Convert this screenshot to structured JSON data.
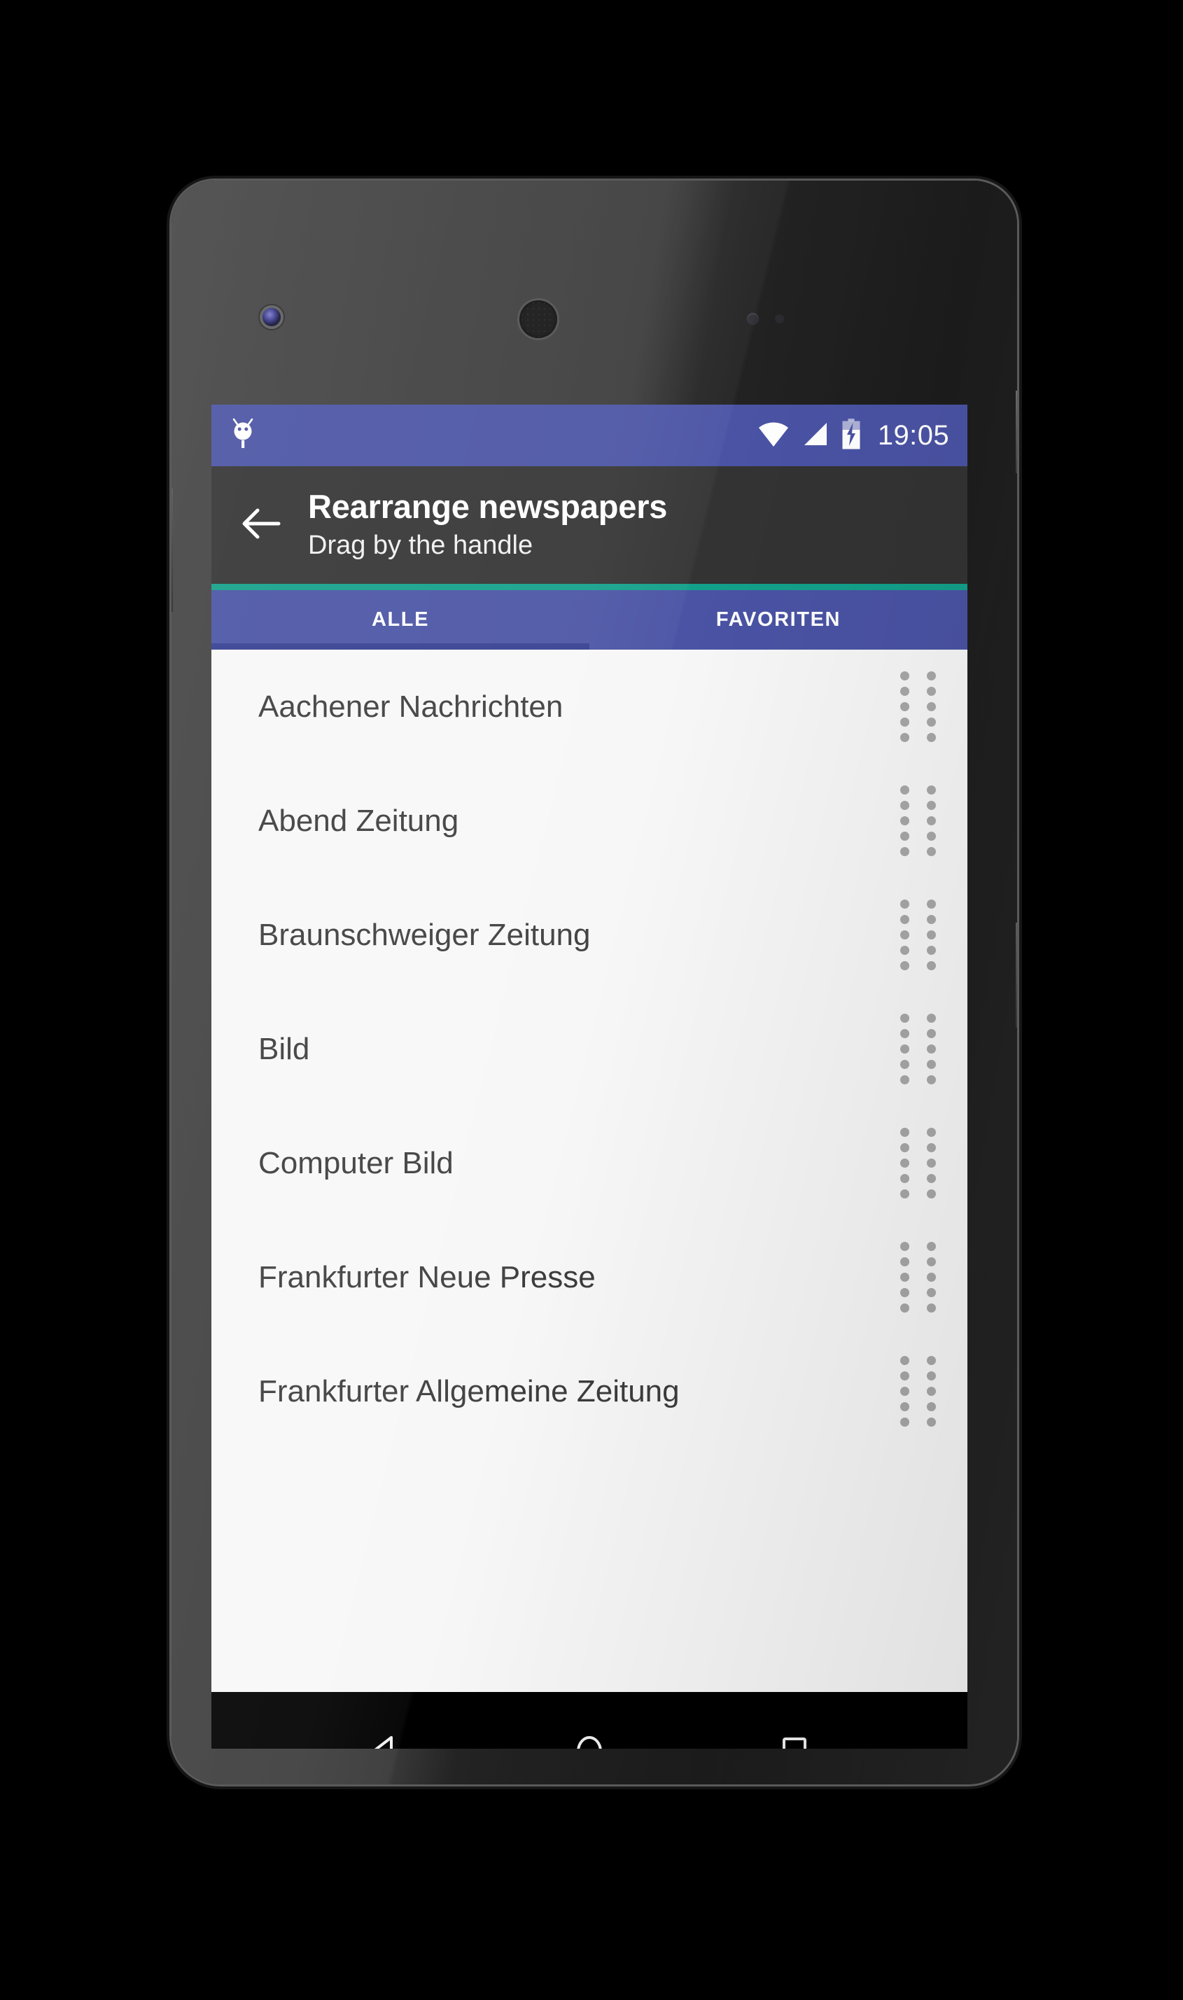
{
  "device": {
    "name": "android-phone-nexus-5",
    "camera_icon": "front-camera-icon",
    "speaker_icon": "earpiece-speaker-icon"
  },
  "status_bar": {
    "notification_icon": "android-robot-icon",
    "wifi_icon": "wifi-icon",
    "signal_icon": "cellular-signal-icon",
    "battery_icon": "battery-charging-icon",
    "time": "19:05",
    "background_color": "#4a53a4"
  },
  "app_bar": {
    "back_icon": "back-arrow-icon",
    "title": "Rearrange newspapers",
    "subtitle": "Drag by the handle",
    "background_color": "#333333",
    "accent_color": "#13a08a"
  },
  "tabs": {
    "selected_index": 0,
    "items": [
      {
        "label": "ALLE"
      },
      {
        "label": "FAVORITEN"
      }
    ],
    "indicator_color": "#343e90",
    "background_color": "#4a53a4"
  },
  "list": {
    "handle_icon": "drag-handle-dots-icon",
    "items": [
      {
        "label": "Aachener Nachrichten"
      },
      {
        "label": "Abend Zeitung"
      },
      {
        "label": "Braunschweiger Zeitung"
      },
      {
        "label": "Bild"
      },
      {
        "label": "Computer Bild"
      },
      {
        "label": "Frankfurter Neue Presse"
      },
      {
        "label": "Frankfurter Allgemeine Zeitung"
      }
    ]
  },
  "nav_bar": {
    "back_icon": "nav-back-triangle-icon",
    "home_icon": "nav-home-circle-icon",
    "recents_icon": "nav-recents-square-icon",
    "background_color": "#000000"
  }
}
